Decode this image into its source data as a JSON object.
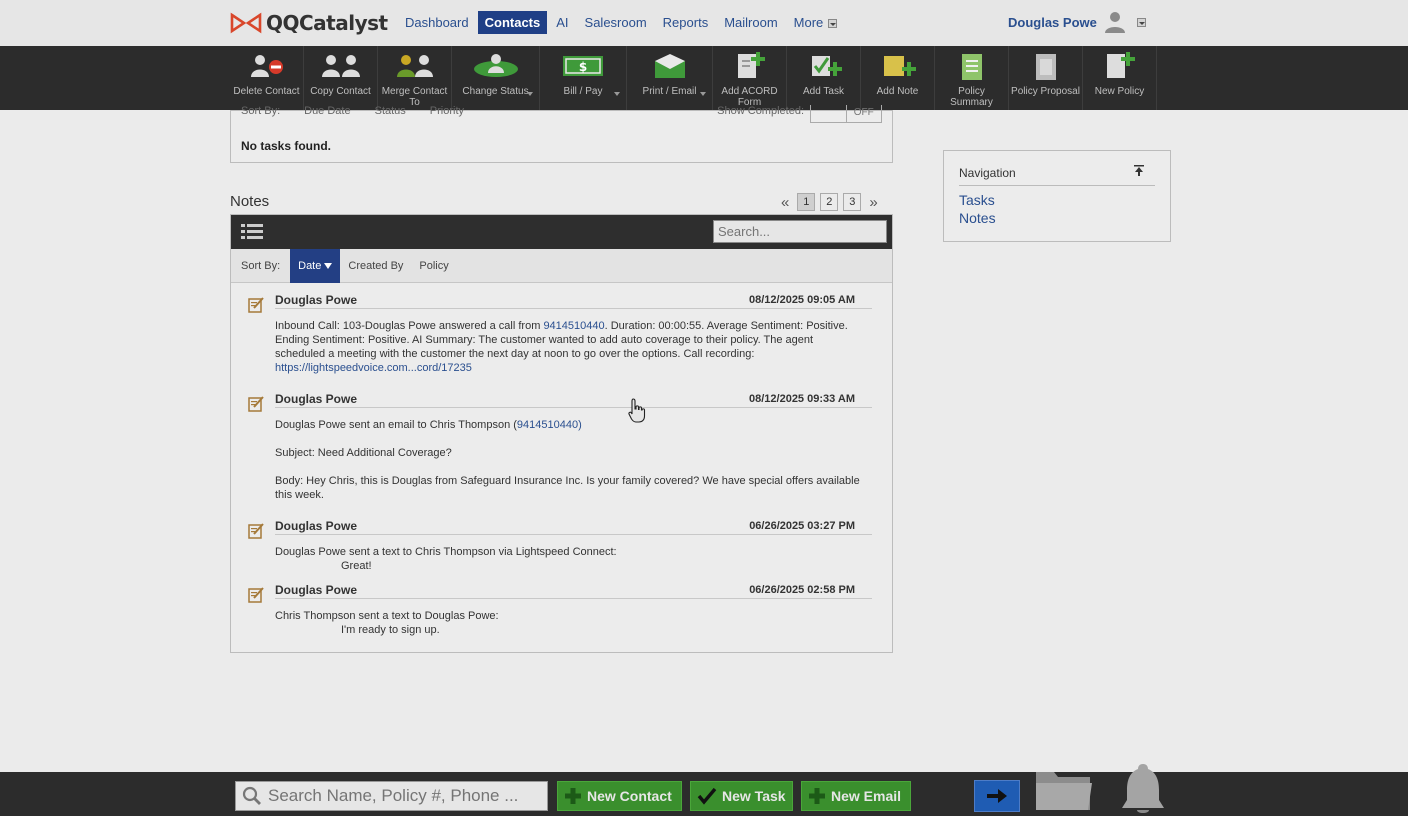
{
  "app": {
    "logo_text": "QQCatalyst"
  },
  "nav": {
    "items": [
      {
        "label": "Dashboard",
        "active": false
      },
      {
        "label": "Contacts",
        "active": true
      },
      {
        "label": "AI",
        "active": false
      },
      {
        "label": "Salesroom",
        "active": false
      },
      {
        "label": "Reports",
        "active": false
      },
      {
        "label": "Mailroom",
        "active": false
      }
    ],
    "more_label": "More"
  },
  "user": {
    "name": "Douglas Powe"
  },
  "toolbar": {
    "delete_contact": "Delete Contact",
    "copy_contact": "Copy Contact",
    "merge_contact": "Merge Contact To",
    "change_status": "Change Status",
    "bill_pay": "Bill / Pay",
    "print_email": "Print / Email",
    "add_acord": "Add ACORD Form",
    "add_task": "Add Task",
    "add_note": "Add Note",
    "policy_summary": "Policy Summary",
    "policy_proposal": "Policy Proposal",
    "new_policy": "New Policy"
  },
  "tasks": {
    "sort_by": "Sort By:",
    "sort_options": [
      "Due Date",
      "Status",
      "Priority"
    ],
    "show_completed": "Show Completed:",
    "toggle_off": "OFF",
    "empty_message": "No tasks found."
  },
  "notes": {
    "title": "Notes",
    "pager": {
      "prev": "«",
      "next": "»",
      "pages": [
        "1",
        "2",
        "3"
      ],
      "current": "1"
    },
    "search_placeholder": "Search...",
    "sort_label": "Sort By:",
    "sort_options": [
      {
        "label": "Date",
        "active": true
      },
      {
        "label": "Created By",
        "active": false
      },
      {
        "label": "Policy",
        "active": false
      }
    ],
    "items": [
      {
        "author": "Douglas Powe",
        "date": "08/12/2025 09:05 AM",
        "body_prefix": "Inbound Call: 103-Douglas Powe answered a call from ",
        "phone": "9414510440",
        "body_rest": ". Duration: 00:00:55. Average Sentiment: Positive. Ending Sentiment: Positive. AI Summary: The customer wanted to add auto coverage to their policy. The agent scheduled a meeting with the customer the next day at noon to go over the options. Call recording:",
        "link": "https://lightspeedvoice.com...cord/17235"
      },
      {
        "author": "Douglas Powe",
        "date": "08/12/2025 09:33 AM",
        "line1_prefix": "Douglas Powe sent an email to Chris Thompson (",
        "phone": "9414510440",
        "line1_suffix": ")",
        "subject": "Subject: Need Additional Coverage?",
        "body": "Body: Hey Chris, this is Douglas from Safeguard Insurance Inc. Is your family covered? We have special offers available this week."
      },
      {
        "author": "Douglas Powe",
        "date": "06/26/2025 03:27 PM",
        "line1": "Douglas Powe sent a text to Chris Thompson via Lightspeed Connect:",
        "line2": "Great!"
      },
      {
        "author": "Douglas Powe",
        "date": "06/26/2025 02:58 PM",
        "line1": "Chris Thompson sent a text to Douglas Powe:",
        "line2": "I'm ready to sign up."
      }
    ]
  },
  "navigation_box": {
    "title": "Navigation",
    "links": [
      "Tasks",
      "Notes"
    ]
  },
  "bottom": {
    "search_placeholder": "Search Name, Policy #, Phone ...",
    "new_contact": "New Contact",
    "new_task": "New Task",
    "new_email": "New Email"
  },
  "colors": {
    "accent": "#1f3f86",
    "toolbar_bg": "#2c2c2c",
    "green_button": "#3a8f2d",
    "link": "#2a4f8f"
  }
}
